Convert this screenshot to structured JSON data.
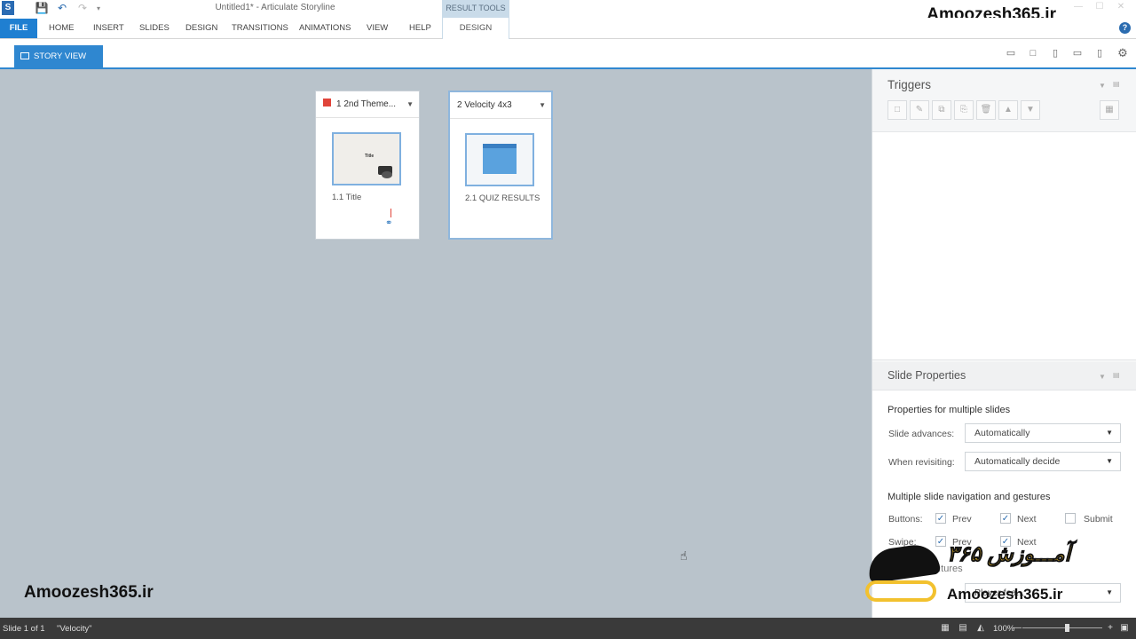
{
  "window": {
    "title": "Untitled1* - Articulate Storyline",
    "context_tab_header": "RESULT TOOLS",
    "brand_top": "Amoozesh365.ir"
  },
  "ribbon": {
    "tabs": [
      "FILE",
      "HOME",
      "INSERT",
      "SLIDES",
      "DESIGN",
      "TRANSITIONS",
      "ANIMATIONS",
      "VIEW",
      "HELP"
    ],
    "context_tab": "DESIGN"
  },
  "viewbar": {
    "story_view_label": "STORY VIEW"
  },
  "scenes": [
    {
      "title": "1 2nd Theme...",
      "has_flag": true,
      "slide_label": "1.1 Title",
      "thumb_text": "Title"
    },
    {
      "title": "2 Velocity 4x3",
      "has_flag": false,
      "slide_label": "2.1 QUIZ RESULTS",
      "thumb_text": ""
    }
  ],
  "triggers_panel": {
    "title": "Triggers",
    "buttons": [
      "new-trigger-icon",
      "edit-trigger-icon",
      "copy-trigger-icon",
      "paste-trigger-icon",
      "delete-trigger-icon",
      "move-up-icon",
      "move-down-icon"
    ]
  },
  "slide_properties": {
    "title": "Slide Properties",
    "section1": "Properties for multiple slides",
    "slide_advances_label": "Slide advances:",
    "slide_advances_value": "Automatically",
    "when_revisiting_label": "When revisiting:",
    "when_revisiting_value": "Automatically decide",
    "section2": "Multiple slide navigation and gestures",
    "buttons_label": "Buttons:",
    "swipe_label": "Swipe:",
    "prev_label": "Prev",
    "next_label": "Next",
    "submit_label": "Submit",
    "buttons_prev_checked": true,
    "buttons_next_checked": true,
    "buttons_submit_checked": false,
    "swipe_prev_checked": true,
    "swipe_next_checked": true,
    "partial_label": "Player fea...",
    "partial_label2": "...tures"
  },
  "watermark": {
    "left_text": "Amoozesh365.ir",
    "right_text": "Amoozesh365.ir",
    "script_text": "آمـــوزش ۳۶۵"
  },
  "status": {
    "slide_info": "Slide 1 of 1",
    "theme": "\"Velocity\"",
    "zoom": "100%"
  }
}
